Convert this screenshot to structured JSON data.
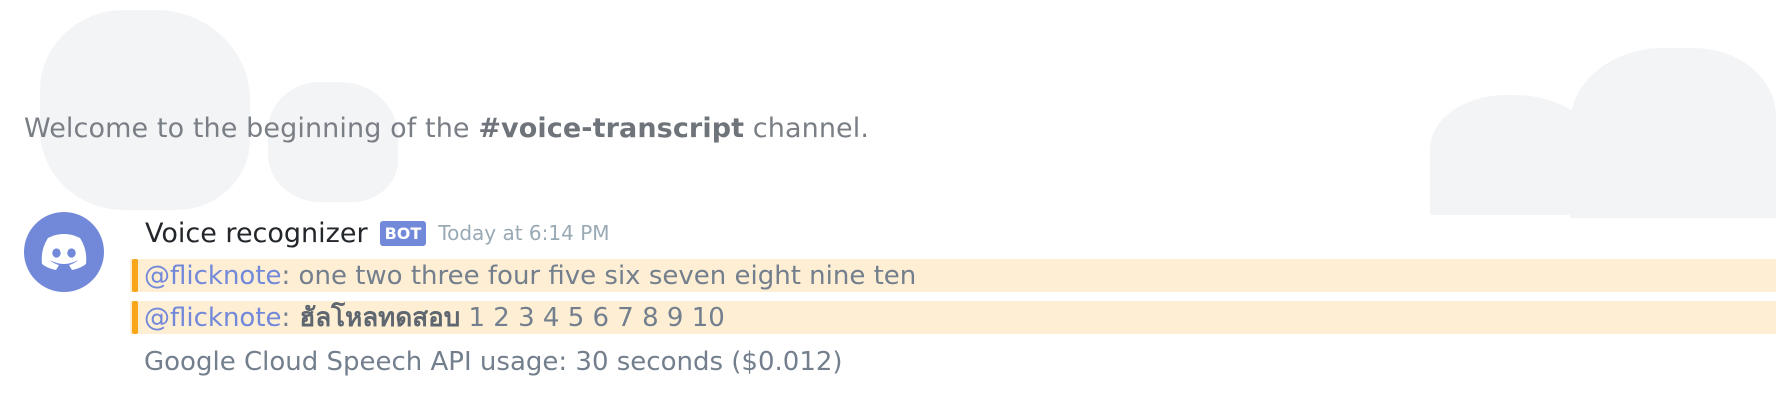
{
  "welcome": {
    "prefix": "Welcome to the beginning of the ",
    "channel": "#voice-transcript",
    "suffix": " channel."
  },
  "message": {
    "avatar_icon": "discord-logo-icon",
    "username": "Voice recognizer",
    "bot_tag": "BOT",
    "timestamp": "Today at 6:14 PM",
    "lines": [
      {
        "mention": "@flicknote",
        "separator": ":",
        "text": " one two three four five six seven eight nine ten"
      },
      {
        "mention": "@flicknote",
        "separator": ":",
        "thai": " ฮัลโหลทดสอบ",
        "text": " 1 2 3 4 5 6 7 8 9 10"
      }
    ],
    "footer": "Google Cloud Speech API usage: 30 seconds ($0.012)"
  },
  "colors": {
    "accent": "#7289da",
    "mention_bg": "#fdeed4",
    "mention_bar": "#faa61a"
  }
}
